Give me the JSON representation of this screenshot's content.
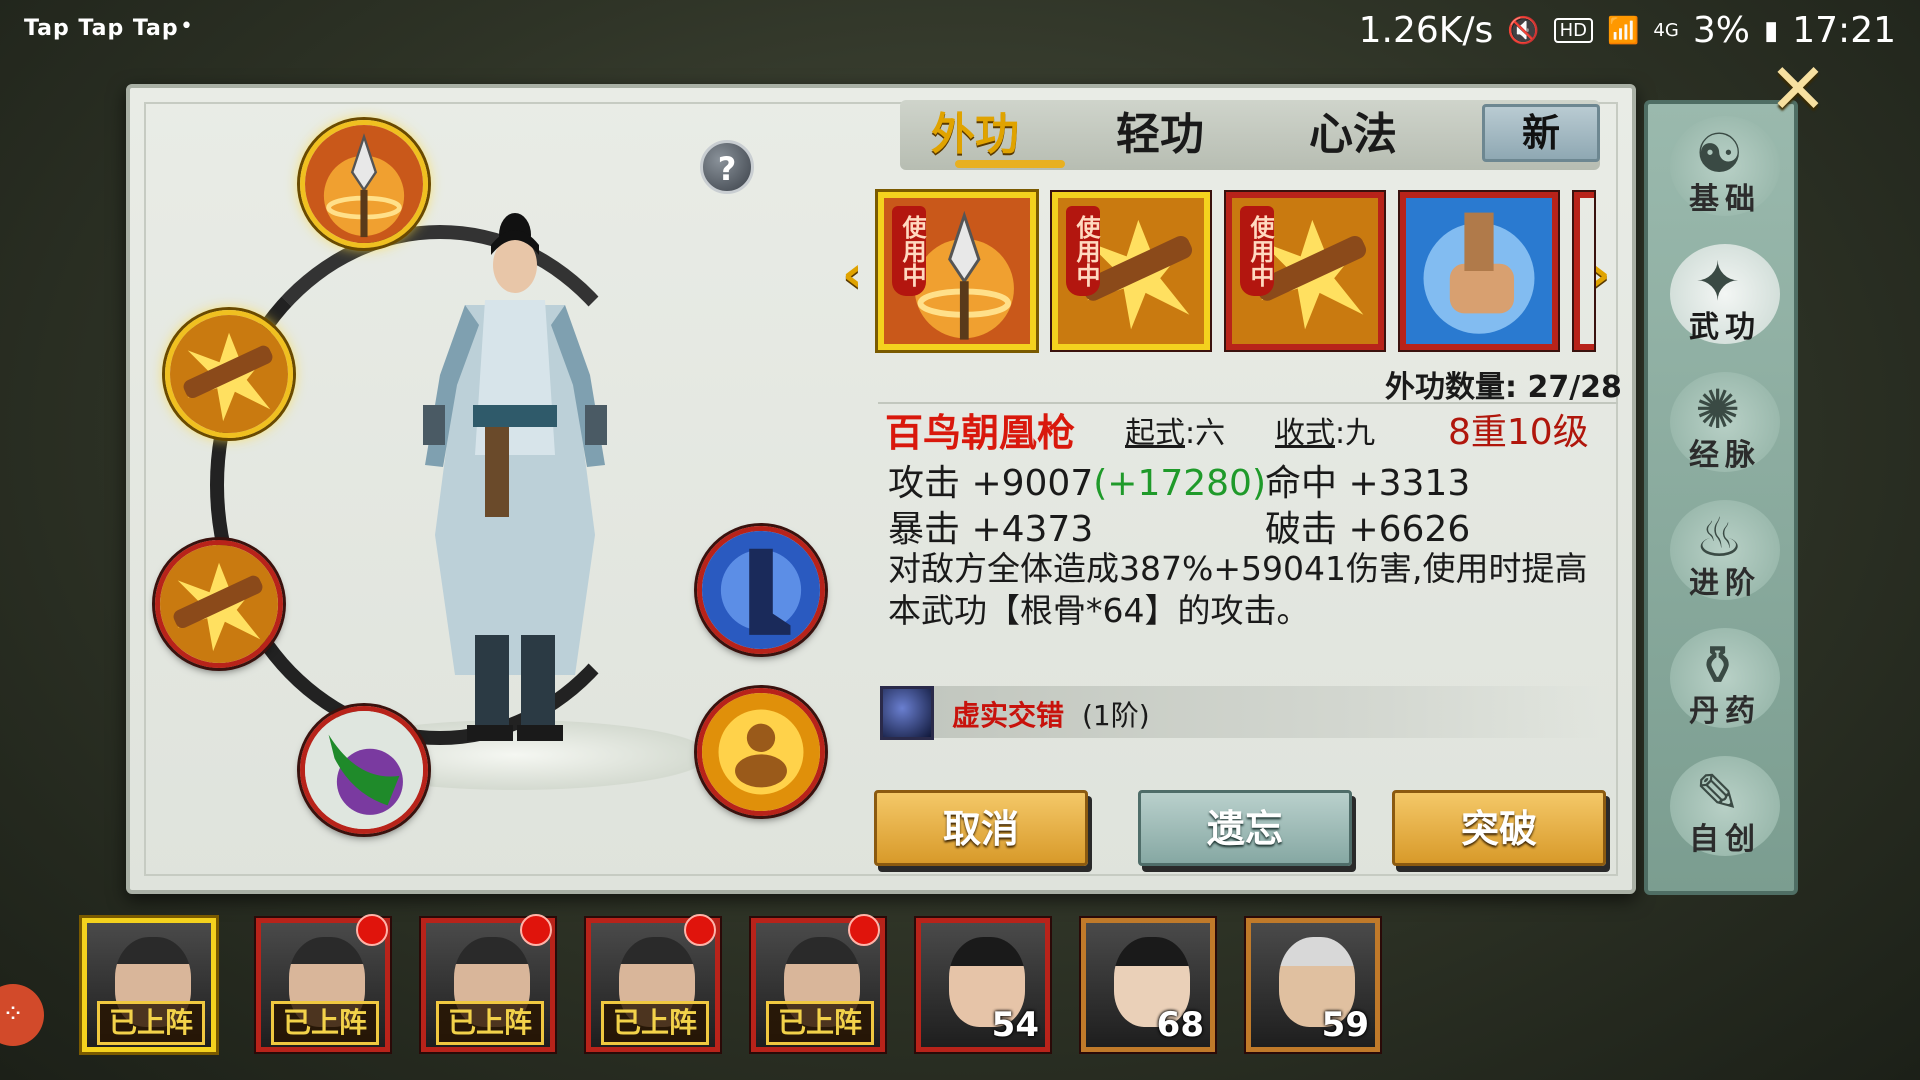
{
  "status_bar": {
    "app_name": "Tap Tap Tap",
    "dot": "•",
    "net_speed": "1.26K/s",
    "hd": "HD",
    "network": "4G",
    "battery": "3%",
    "time": "17:21",
    "icons": [
      "mute-icon",
      "wifi-icon",
      "signal-icon",
      "battery-icon"
    ]
  },
  "tabs": {
    "items": [
      "外功",
      "轻功",
      "心法"
    ],
    "active": "外功",
    "new_label": "新"
  },
  "help_label": "?",
  "skill_cards": [
    {
      "icon": "spear-icon",
      "using": "使用中",
      "selected": true
    },
    {
      "icon": "staff-strike-icon",
      "using": "使用中",
      "selected": false
    },
    {
      "icon": "staff-strike-icon",
      "using": "使用中",
      "selected": false
    },
    {
      "icon": "fist-icon",
      "using": "",
      "selected": false
    }
  ],
  "count_label": "外功数量: 27/28",
  "skill": {
    "name": "百鸟朝凰枪",
    "stance_start_label": "起式",
    "stance_start_value": ":六",
    "stance_end_label": "收式",
    "stance_end_value": ":九",
    "level": "8重10级",
    "attack": "攻击 +9007",
    "attack_bonus": "(+17280)",
    "hit": "命中 +3313",
    "crit": "暴击 +4373",
    "pierce": "破击 +6626",
    "description": "对敌方全体造成387%+59041伤害,使用时提高本武功【根骨*64】的攻击。"
  },
  "passive": {
    "name": "虚实交错",
    "tier": "(1阶)"
  },
  "buttons": {
    "cancel": "取消",
    "forget": "遗忘",
    "breakthrough": "突破"
  },
  "sidebar": [
    {
      "label": "基础",
      "icon": "basic-icon",
      "glyph": "☯"
    },
    {
      "label": "武功",
      "icon": "martial-arts-icon",
      "glyph": "✦",
      "active": true
    },
    {
      "label": "经脉",
      "icon": "meridian-icon",
      "glyph": "✺"
    },
    {
      "label": "进阶",
      "icon": "advance-icon",
      "glyph": "♨"
    },
    {
      "label": "丹药",
      "icon": "pill-icon",
      "glyph": "⚱"
    },
    {
      "label": "自创",
      "icon": "create-icon",
      "glyph": "✎"
    }
  ],
  "close_label": "✕",
  "roster": [
    {
      "status": "已上阵",
      "selected": true,
      "red_dot": false
    },
    {
      "status": "已上阵",
      "selected": false,
      "red_dot": true
    },
    {
      "status": "已上阵",
      "selected": false,
      "red_dot": true
    },
    {
      "status": "已上阵",
      "selected": false,
      "red_dot": true
    },
    {
      "status": "已上阵",
      "selected": false,
      "red_dot": true
    },
    {
      "level": "54"
    },
    {
      "level": "68"
    },
    {
      "level": "59"
    }
  ],
  "colors": {
    "skill_name": "#d9180c",
    "bonus": "#1f9a2a",
    "gold": "#e0a300",
    "frame_red": "#b8231a"
  }
}
